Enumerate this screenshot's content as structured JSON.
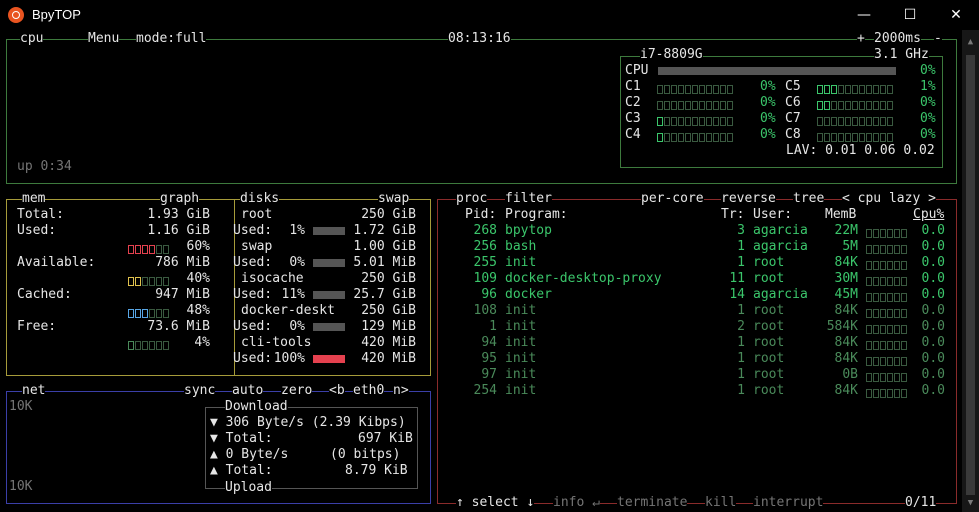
{
  "window": {
    "title": "BpyTOP",
    "min": "—",
    "max": "☐",
    "close": "✕"
  },
  "cpu": {
    "box_label": "cpu",
    "menu": "Menu",
    "mode": "mode:full",
    "clock": "08:13:16",
    "plus": "+",
    "interval": "2000ms",
    "minus": "-",
    "model": "i7-8809G",
    "freq": "3.1 GHz",
    "total_label": "CPU",
    "total_pct": "0%",
    "cores": [
      {
        "name": "C1",
        "pct": "0%",
        "level": 0.0
      },
      {
        "name": "C2",
        "pct": "0%",
        "level": 0.0
      },
      {
        "name": "C3",
        "pct": "0%",
        "level": 0.1
      },
      {
        "name": "C4",
        "pct": "0%",
        "level": 0.1
      },
      {
        "name": "C5",
        "pct": "1%",
        "level": 0.3
      },
      {
        "name": "C6",
        "pct": "0%",
        "level": 0.2
      },
      {
        "name": "C7",
        "pct": "0%",
        "level": 0.0
      },
      {
        "name": "C8",
        "pct": "0%",
        "level": 0.0
      }
    ],
    "lav": "LAV: 0.01 0.06 0.02",
    "uptime": "up 0:34"
  },
  "mem": {
    "box_label": "mem",
    "graph": "graph",
    "rows": [
      {
        "label": "Total:",
        "value": "1.93 GiB"
      },
      {
        "label": "Used:",
        "value": "1.16 GiB",
        "pct": "60%",
        "color": "#e5414f"
      },
      {
        "label": "Available:",
        "value": "786 MiB",
        "pct": "40%",
        "color": "#e0c24e"
      },
      {
        "label": "Cached:",
        "value": "947 MiB",
        "pct": "48%",
        "color": "#58a6e6"
      },
      {
        "label": "Free:",
        "value": "73.6 MiB",
        "pct": "4%",
        "color": "#4a8a5a"
      }
    ]
  },
  "disks": {
    "box_label": "disks",
    "swap": "swap",
    "items": [
      {
        "name": "root",
        "total": "250 GiB",
        "used_label": "Used:",
        "used_pct": "1%",
        "used": "1.72 GiB",
        "level": 0.01
      },
      {
        "name": "swap",
        "total": "1.00 GiB",
        "used_label": "Used:",
        "used_pct": "0%",
        "used": "5.01 MiB",
        "level": 0.0
      },
      {
        "name": "isocache",
        "total": "250 GiB",
        "used_label": "Used:",
        "used_pct": "11%",
        "used": "25.7 GiB",
        "level": 0.11
      },
      {
        "name": "docker-deskt",
        "total": "250 GiB",
        "used_label": "Used:",
        "used_pct": "0%",
        "used": "129 MiB",
        "level": 0.0
      },
      {
        "name": "cli-tools",
        "total": "420 MiB",
        "used_label": "Used:",
        "used_pct": "100%",
        "used": "420 MiB",
        "level": 1.0
      }
    ]
  },
  "net": {
    "box_label": "net",
    "sync": "sync",
    "auto": "auto",
    "zero": "zero",
    "prev": "<b",
    "iface": "eth0",
    "next": "n>",
    "scale_top": "10K",
    "scale_bottom": "10K",
    "download": "Download",
    "upload": "Upload",
    "dl_rate": "▼ 306 Byte/s (2.39 Kibps)",
    "dl_total_label": "▼ Total:",
    "dl_total": "697 KiB",
    "ul_rate_a": "▲ 0 Byte/s",
    "ul_rate_b": "(0 bitps)",
    "ul_total_label": "▲ Total:",
    "ul_total": "8.79 KiB"
  },
  "proc": {
    "box_label": "proc",
    "filter": "filter",
    "per_core": "per-core",
    "reverse": "reverse",
    "tree": "tree",
    "sort": "< cpu lazy >",
    "headers": {
      "pid": "Pid:",
      "program": "Program:",
      "tr": "Tr:",
      "user": "User:",
      "memb": "MemB",
      "cpu": "Cpu%"
    },
    "rows": [
      {
        "pid": "268",
        "program": "bpytop",
        "tr": "3",
        "user": "agarcia",
        "mem": "22M",
        "cpu": "0.0"
      },
      {
        "pid": "256",
        "program": "bash",
        "tr": "1",
        "user": "agarcia",
        "mem": "5M",
        "cpu": "0.0"
      },
      {
        "pid": "255",
        "program": "init",
        "tr": "1",
        "user": "root",
        "mem": "84K",
        "cpu": "0.0"
      },
      {
        "pid": "109",
        "program": "docker-desktop-proxy",
        "tr": "11",
        "user": "root",
        "mem": "30M",
        "cpu": "0.0"
      },
      {
        "pid": "96",
        "program": "docker",
        "tr": "14",
        "user": "agarcia",
        "mem": "45M",
        "cpu": "0.0"
      },
      {
        "pid": "108",
        "program": "init",
        "tr": "1",
        "user": "root",
        "mem": "84K",
        "cpu": "0.0"
      },
      {
        "pid": "1",
        "program": "init",
        "tr": "2",
        "user": "root",
        "mem": "584K",
        "cpu": "0.0"
      },
      {
        "pid": "94",
        "program": "init",
        "tr": "1",
        "user": "root",
        "mem": "84K",
        "cpu": "0.0"
      },
      {
        "pid": "95",
        "program": "init",
        "tr": "1",
        "user": "root",
        "mem": "84K",
        "cpu": "0.0"
      },
      {
        "pid": "97",
        "program": "init",
        "tr": "1",
        "user": "root",
        "mem": "0B",
        "cpu": "0.0"
      },
      {
        "pid": "254",
        "program": "init",
        "tr": "1",
        "user": "root",
        "mem": "84K",
        "cpu": "0.0"
      }
    ],
    "footer": {
      "select": "↑ select ↓",
      "info": "info ↵",
      "terminate": "terminate",
      "kill": "kill",
      "interrupt": "interrupt",
      "count": "0/11"
    }
  },
  "colors": {
    "cpu_border": "#3d7a3d",
    "mem_border": "#a69b3a",
    "net_border": "#3b3fa8",
    "proc_border": "#8a2b2b"
  }
}
